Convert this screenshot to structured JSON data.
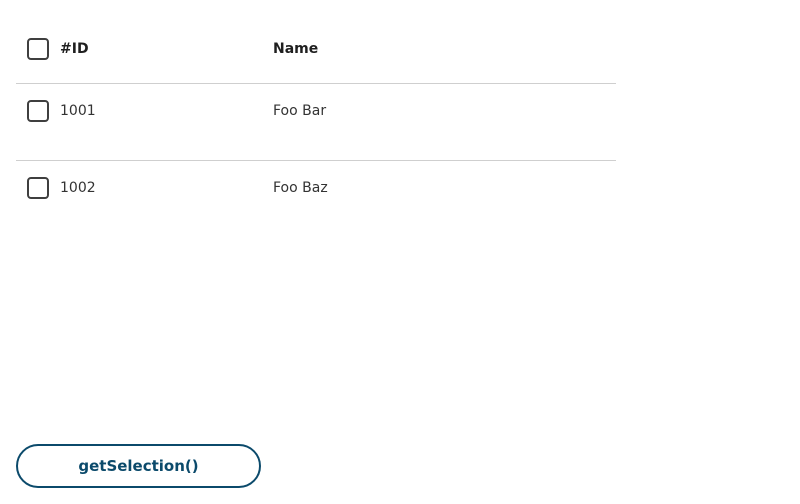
{
  "table": {
    "columns": {
      "id": "#ID",
      "name": "Name"
    },
    "rows": [
      {
        "id": "1001",
        "name": "Foo Bar",
        "selected": false
      },
      {
        "id": "1002",
        "name": "Foo Baz",
        "selected": false
      }
    ],
    "select_all": false
  },
  "actions": {
    "get_selection_label": "getSelection()"
  },
  "colors": {
    "accent": "#0b4a6b",
    "checkbox_border": "#3f3f3f",
    "divider": "#cfcfcf"
  }
}
